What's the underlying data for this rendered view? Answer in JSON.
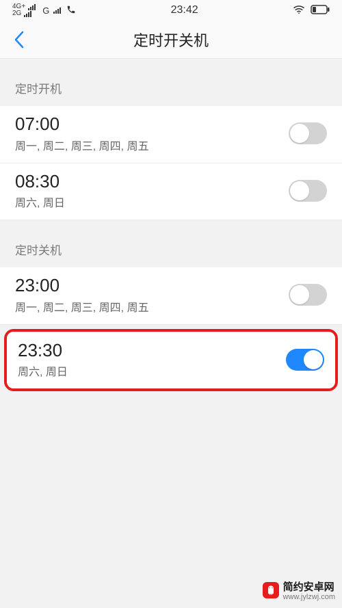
{
  "status": {
    "net1": "4G+",
    "net2": "2G",
    "netG": "G",
    "time": "23:42"
  },
  "header": {
    "title": "定时开关机"
  },
  "sections": {
    "on": {
      "label": "定时开机",
      "items": [
        {
          "time": "07:00",
          "days": "周一, 周二, 周三, 周四, 周五",
          "enabled": false
        },
        {
          "time": "08:30",
          "days": "周六, 周日",
          "enabled": false
        }
      ]
    },
    "off": {
      "label": "定时关机",
      "items": [
        {
          "time": "23:00",
          "days": "周一, 周二, 周三, 周四, 周五",
          "enabled": false
        },
        {
          "time": "23:30",
          "days": "周六, 周日",
          "enabled": true,
          "highlighted": true
        }
      ]
    }
  },
  "watermark": {
    "name": "简约安卓网",
    "url": "www.jylzwj.com"
  }
}
